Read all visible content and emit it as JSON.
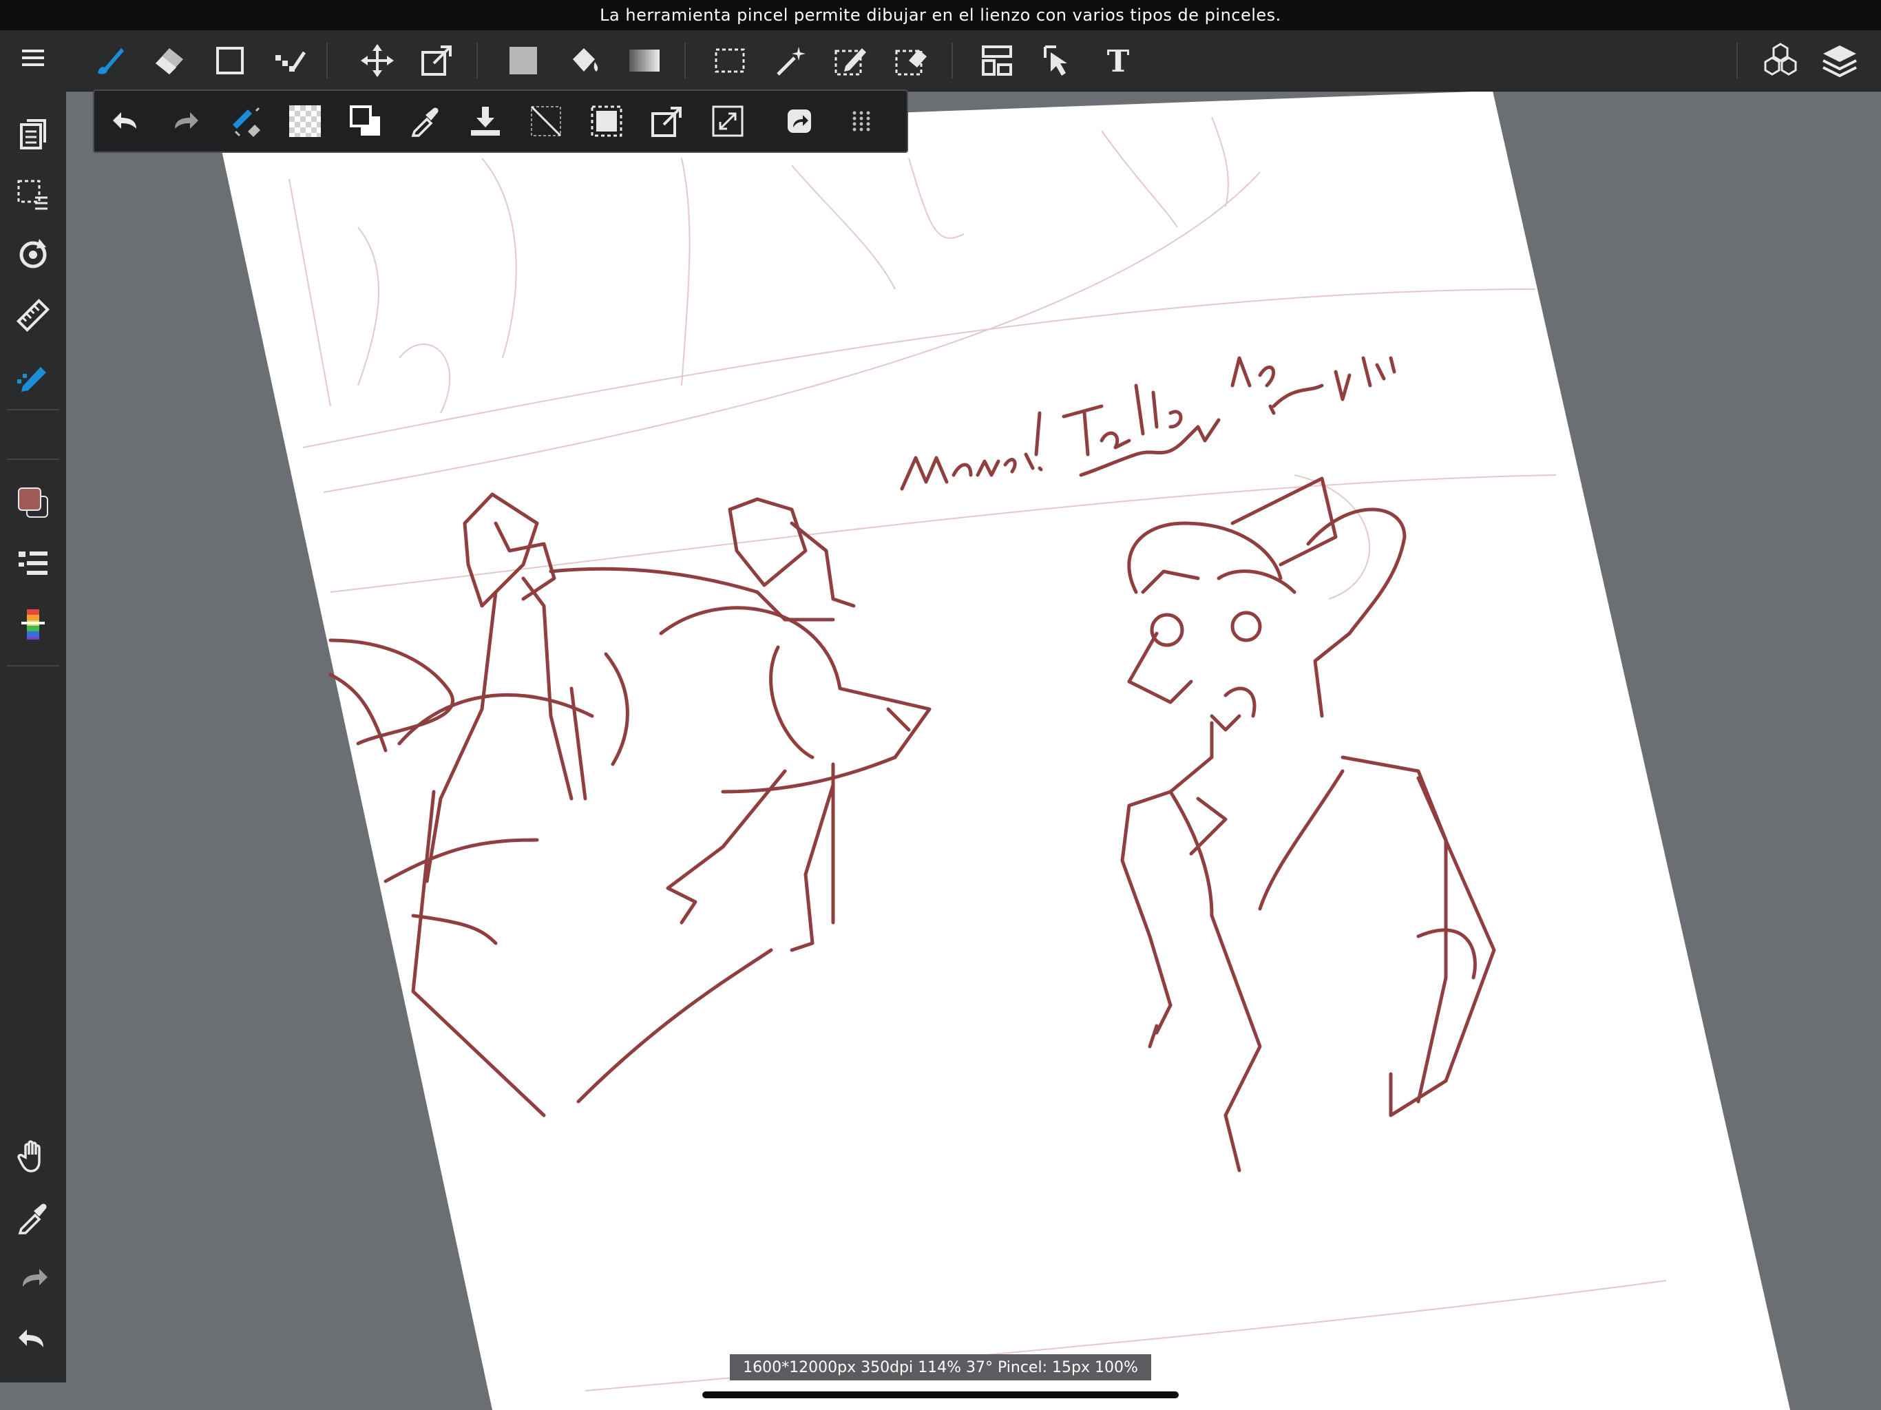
{
  "hint": {
    "text": "La herramienta pincel permite dibujar en el lienzo con varios tipos de pinceles."
  },
  "status": {
    "text": "1600*12000px 350dpi 114% 37° Pincel: 15px 100%"
  },
  "colors": {
    "accent": "#1a8fd8",
    "primary_color": "#a05a58",
    "stroke": "#8f3f3f",
    "canvas": "#ffffff",
    "workspace": "#6b6e73"
  },
  "toolbar": {
    "tools": [
      "brush-icon",
      "eraser-icon",
      "shape-icon",
      "dot-line-icon",
      "move-icon",
      "transform-icon",
      "fill-color-icon",
      "bucket-icon",
      "gradient-icon",
      "select-rect-icon",
      "magic-wand-icon",
      "select-pen-icon",
      "select-eraser-icon",
      "frame-divide-icon",
      "select-layer-icon",
      "text-icon"
    ],
    "right": [
      "materials-icon",
      "layers-icon"
    ]
  },
  "sidebar": {
    "items": [
      "menu-icon",
      "pages-icon",
      "selection-menu-icon",
      "rotate-icon",
      "ruler-icon",
      "snap-pen-icon",
      "color-icon",
      "brush-list-icon",
      "color-palette-icon",
      "hand-icon",
      "eyedropper-icon",
      "redo-icon",
      "undo-icon"
    ]
  },
  "subbar": {
    "items": [
      "undo-icon",
      "redo-icon",
      "color-correct-icon",
      "transparent-icon",
      "swap-colors-icon",
      "eyedropper-icon",
      "download-icon",
      "clear-icon",
      "select-all-icon",
      "transform-icon",
      "fullscreen-icon",
      "share-icon",
      "grip-icon"
    ]
  },
  "sketch": {
    "caption_line1": "Mawmee! take this guy",
    "caption_line2": "away and walk him"
  }
}
